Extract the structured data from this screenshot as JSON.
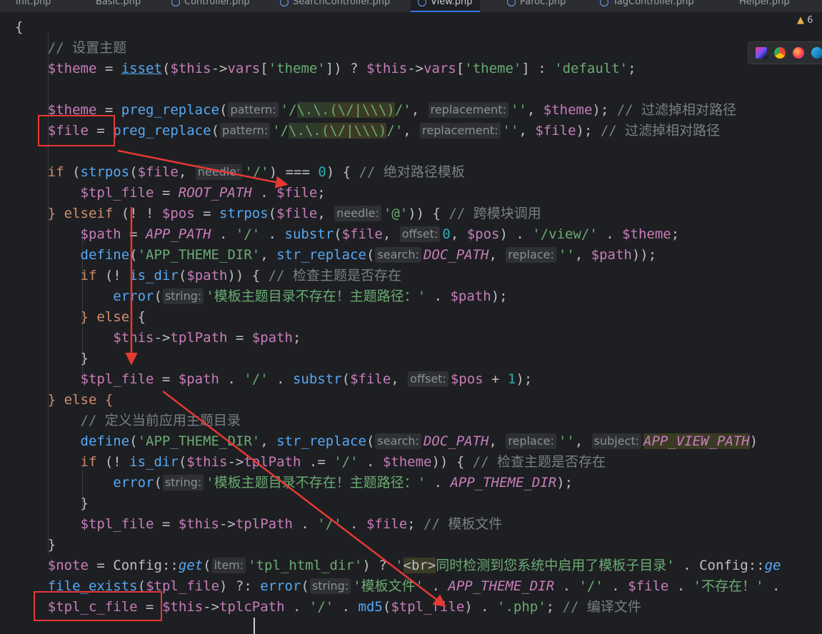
{
  "tabs": [
    {
      "label": "init.php",
      "active": false
    },
    {
      "label": "Basic.php",
      "active": false
    },
    {
      "label": "Controller.php",
      "active": false
    },
    {
      "label": "SearchController.php",
      "active": false
    },
    {
      "label": "View.php",
      "active": true
    },
    {
      "label": "Paroc.php",
      "active": false
    },
    {
      "label": "TagController.php",
      "active": false
    },
    {
      "label": "Helper.php",
      "active": false
    }
  ],
  "warning_count": "6",
  "code": {
    "brace_open": "{",
    "c_theme": "// 设置主题",
    "c_filter": "// 过滤掉相对路径",
    "c_abs": "// 绝对路径模板",
    "c_cross": "// 跨模块调用",
    "c_check": "// 检查主题是否存在",
    "c_define": "// 定义当前应用主题目录",
    "c_tplfile": "// 模板文件",
    "c_compile": "// 编译文件",
    "s_theme": "'theme'",
    "s_default": "'default'",
    "s_regex_a": "'/",
    "s_regex_b": "\\.\\.",
    "s_regex_c": "(\\/|\\\\\\)",
    "s_regex_d": "/'",
    "s_empty": "''",
    "s_slash": "'/'",
    "s_at": "'@'",
    "s_view": "'/view/'",
    "s_theme_dir": "'APP_THEME_DIR'",
    "s_err": "'模板主题目录不存在！主题路径：'",
    "s_tpl_html_dir": "'tpl_html_dir'",
    "s_br_q": "'",
    "s_br_tag": "<br>",
    "s_br_text": "同时检测到您系统中启用了模板子目录'",
    "s_tplfile_q": "'模板文件'",
    "s_notexist": "'不存在！'",
    "s_php": "'.php'",
    "h_pattern": "pattern:",
    "h_replacement": "replacement:",
    "h_needle": "needle:",
    "h_offset": "offset:",
    "h_search": "search:",
    "h_replace": "replace:",
    "h_subject": "subject:",
    "h_string": "string:",
    "h_item": "item:",
    "v_theme": "$theme",
    "v_this": "$this",
    "v_file": "$file",
    "v_tpl_file": "$tpl_file",
    "v_pos": "$pos",
    "v_path": "$path",
    "v_note": "$note",
    "v_tpl_c_file": "$tpl_c_file",
    "f_isset": "isset",
    "f_preg": "preg_replace",
    "f_strpos": "strpos",
    "f_substr": "substr",
    "f_define": "define",
    "f_str_replace": "str_replace",
    "f_is_dir": "is_dir",
    "f_error": "error",
    "f_get": "get",
    "f_file_exists": "file_exists",
    "f_md5": "md5",
    "k_if": "if",
    "k_elseif": "} elseif",
    "k_else": "} else",
    "k_else_open": "} else {",
    "k_close": "}",
    "c_root": "ROOT_PATH",
    "c_app": "APP_PATH",
    "c_doc": "DOC_PATH",
    "c_appview": "APP_VIEW_PATH",
    "c_theme_dir": "APP_THEME_DIR",
    "n_zero": "0",
    "n_one": "1",
    "p_vars": "vars",
    "p_tplPath": "tplPath",
    "p_tplcPath": "tplcPath",
    "cls_config": "Config",
    "cls_config_tail": "Config::",
    "fn_get_tail": "ge"
  },
  "colors": {
    "background": "#1e1f22",
    "keyword": "#cf8e6d",
    "variable": "#c77dbb",
    "function": "#56a8f5",
    "string": "#6aab73",
    "comment": "#7a7e85",
    "number": "#2aacb8",
    "annotation_red": "#e53935"
  }
}
